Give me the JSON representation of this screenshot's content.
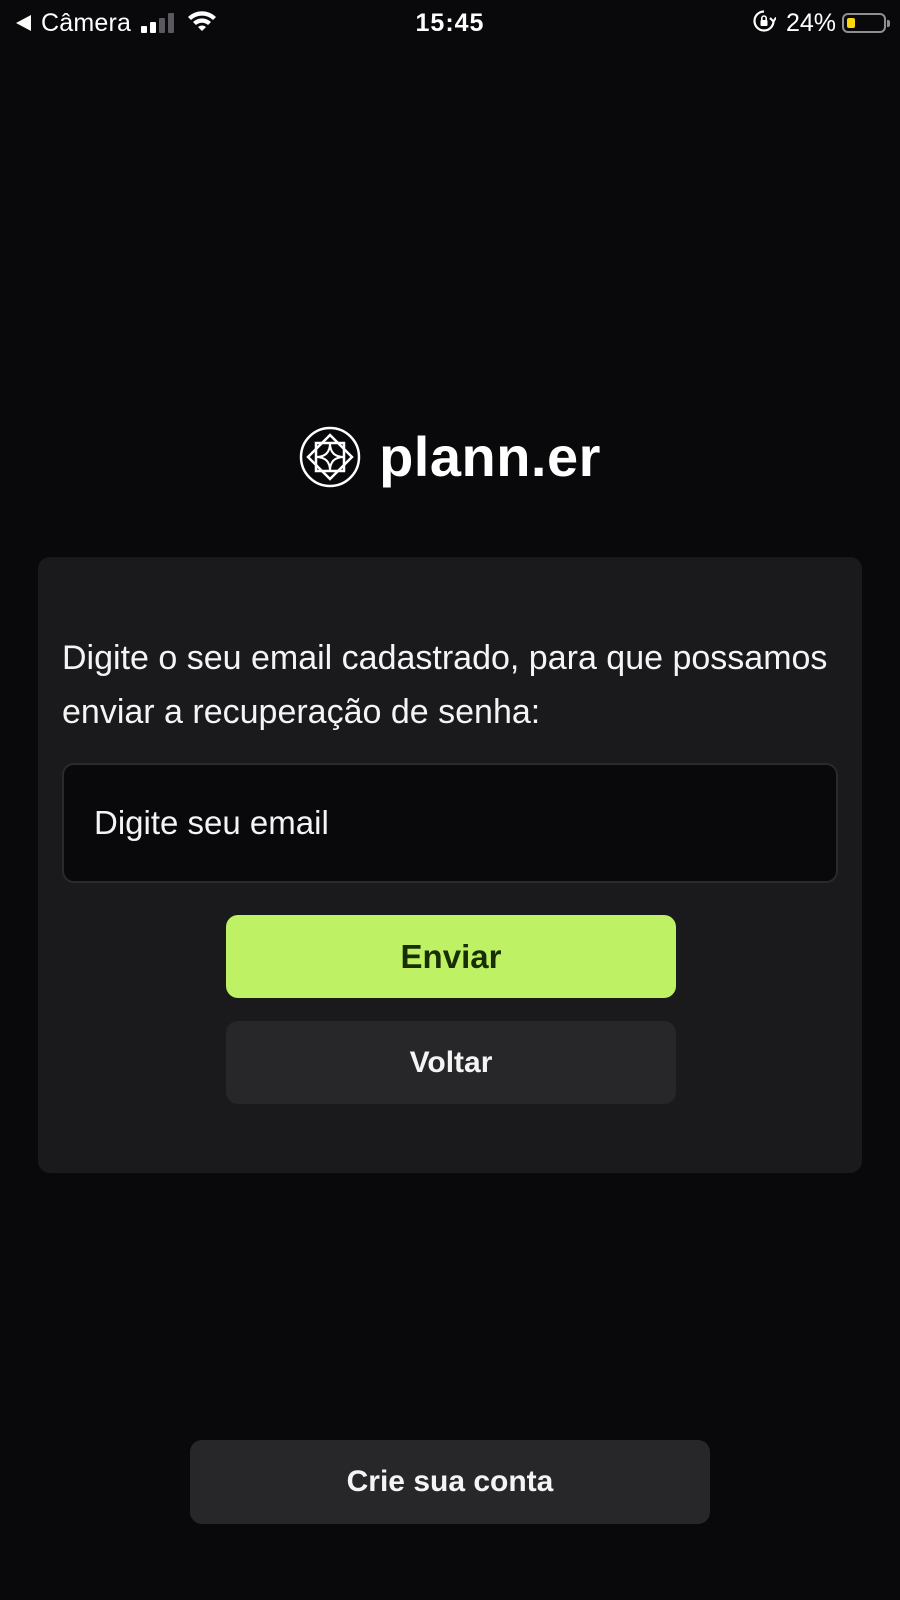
{
  "status_bar": {
    "back_app": "Câmera",
    "time": "15:45",
    "battery": "24%",
    "signal_bars_active": 2,
    "battery_level": 0.24,
    "icons": {
      "back": "back-triangle-icon",
      "signal": "cellular-signal-icon",
      "wifi": "wifi-icon",
      "rotation_lock": "rotation-lock-icon",
      "battery": "battery-icon"
    },
    "colors": {
      "battery_fill": "#ffd60a"
    }
  },
  "logo": {
    "text": "plann.er",
    "icon": "planner-logo-icon"
  },
  "recovery": {
    "instructions": "Digite o seu email cadastrado, para que possamos enviar a recuperação de senha:",
    "email_placeholder": "Digite seu email",
    "email_value": "",
    "send_label": "Enviar",
    "back_label": "Voltar"
  },
  "footer": {
    "create_account_label": "Crie sua conta"
  },
  "colors": {
    "background": "#09090b",
    "card": "#1a1a1c",
    "accent": "#bef264",
    "accent_text": "#1a2e05",
    "secondary_button": "#27272a",
    "text": "#f4f4f5"
  }
}
